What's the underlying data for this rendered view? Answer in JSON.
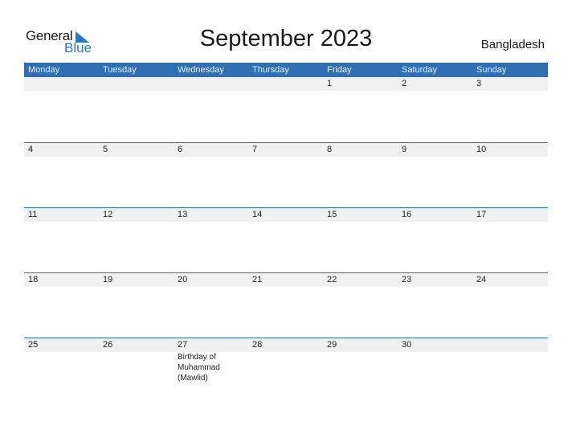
{
  "logo": {
    "word1": "General",
    "word2": "Blue"
  },
  "title": "September 2023",
  "country": "Bangladesh",
  "colors": {
    "accent": "#2e70b3",
    "strip": "#f0f0f0"
  },
  "weekdays": [
    "Monday",
    "Tuesday",
    "Wednesday",
    "Thursday",
    "Friday",
    "Saturday",
    "Sunday"
  ],
  "weeks": [
    {
      "days": [
        "",
        "",
        "",
        "",
        "1",
        "2",
        "3"
      ],
      "events": [
        "",
        "",
        "",
        "",
        "",
        "",
        ""
      ]
    },
    {
      "days": [
        "4",
        "5",
        "6",
        "7",
        "8",
        "9",
        "10"
      ],
      "events": [
        "",
        "",
        "",
        "",
        "",
        "",
        ""
      ]
    },
    {
      "days": [
        "11",
        "12",
        "13",
        "14",
        "15",
        "16",
        "17"
      ],
      "events": [
        "",
        "",
        "",
        "",
        "",
        "",
        ""
      ]
    },
    {
      "days": [
        "18",
        "19",
        "20",
        "21",
        "22",
        "23",
        "24"
      ],
      "events": [
        "",
        "",
        "",
        "",
        "",
        "",
        ""
      ]
    },
    {
      "days": [
        "25",
        "26",
        "27",
        "28",
        "29",
        "30",
        ""
      ],
      "events": [
        "",
        "",
        "Birthday of Muhammad (Mawlid)",
        "",
        "",
        "",
        ""
      ]
    }
  ]
}
